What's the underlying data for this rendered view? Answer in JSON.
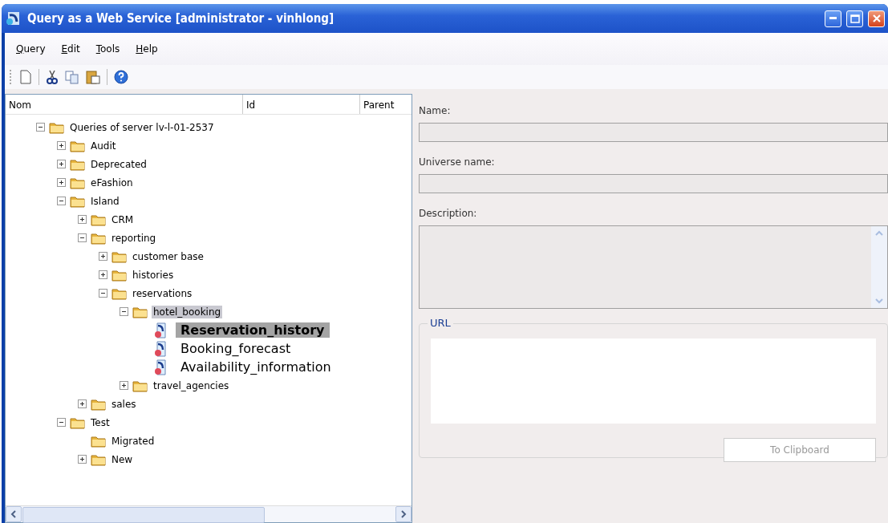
{
  "window": {
    "title": "Query as a Web Service [administrator - vinhlong]"
  },
  "menu": [
    {
      "label": "Query"
    },
    {
      "label": "Edit"
    },
    {
      "label": "Tools"
    },
    {
      "label": "Help"
    }
  ],
  "tree": {
    "columns": [
      "Nom",
      "Id",
      "Parent"
    ],
    "items": [
      {
        "label": "Queries of server lv-l-01-2537",
        "kind": "folder",
        "expanded": true,
        "selected": false,
        "children": [
          {
            "label": "Audit",
            "kind": "folder",
            "expanded": false,
            "selected": false
          },
          {
            "label": "Deprecated",
            "kind": "folder",
            "expanded": false,
            "selected": false
          },
          {
            "label": "eFashion",
            "kind": "folder",
            "expanded": false,
            "selected": false
          },
          {
            "label": "Island",
            "kind": "folder",
            "expanded": true,
            "selected": false,
            "children": [
              {
                "label": "CRM",
                "kind": "folder",
                "expanded": false,
                "selected": false
              },
              {
                "label": "reporting",
                "kind": "folder",
                "expanded": true,
                "selected": false,
                "children": [
                  {
                    "label": "customer base",
                    "kind": "folder",
                    "expanded": false,
                    "selected": false
                  },
                  {
                    "label": "histories",
                    "kind": "folder",
                    "expanded": false,
                    "selected": false
                  },
                  {
                    "label": "reservations",
                    "kind": "folder",
                    "expanded": true,
                    "selected": false,
                    "children": [
                      {
                        "label": "hotel_booking",
                        "kind": "folder",
                        "expanded": true,
                        "selected": true,
                        "children": [
                          {
                            "label": "Reservation_history",
                            "kind": "query",
                            "selected": true
                          },
                          {
                            "label": "Booking_forecast",
                            "kind": "query",
                            "selected": false
                          },
                          {
                            "label": "Availability_information",
                            "kind": "query",
                            "selected": false
                          }
                        ]
                      },
                      {
                        "label": "travel_agencies",
                        "kind": "folder",
                        "expanded": false,
                        "selected": false
                      }
                    ]
                  }
                ]
              },
              {
                "label": "sales",
                "kind": "folder",
                "expanded": false,
                "selected": false
              }
            ]
          },
          {
            "label": "Test",
            "kind": "folder",
            "expanded": true,
            "selected": false,
            "children": [
              {
                "label": "Migrated",
                "kind": "folder",
                "selected": false
              },
              {
                "label": "New",
                "kind": "folder",
                "expanded": false,
                "selected": false
              }
            ]
          }
        ]
      }
    ]
  },
  "details": {
    "name_label": "Name:",
    "universe_label": "Universe name:",
    "description_label": "Description:",
    "url_group": "URL",
    "clipboard_button": {
      "label": "To Clipboard",
      "disabled": true
    }
  }
}
